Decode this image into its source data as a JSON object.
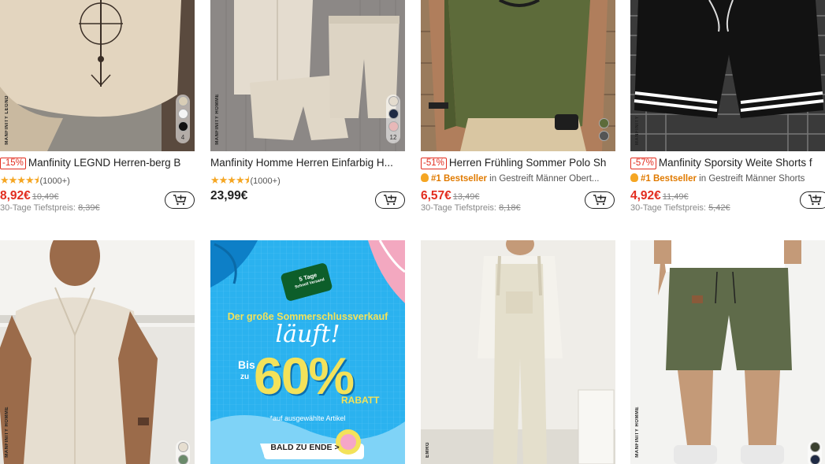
{
  "products": [
    {
      "brand_vertical": "MANFINITY LEGND",
      "discount": "-15%",
      "title": "Manfinity LEGND Herren-berg B",
      "rating_count": "(1000+)",
      "price": "8,92€",
      "old_price": "10,49€",
      "low_label": "30-Tage Tiefstpreis:",
      "low_price": "8,39€",
      "swatch_count": "4"
    },
    {
      "brand_vertical": "MANFINITY HOMME",
      "title": "Manfinity Homme Herren Einfarbig H...",
      "rating_count": "(1000+)",
      "price": "23,99€",
      "swatch_count": "12"
    },
    {
      "discount": "-51%",
      "title": "Herren Frühling Sommer Polo Sh",
      "bestseller": "#1 Bestseller",
      "bestseller_cat": "in Gestreift Männer Obert...",
      "price": "6,57€",
      "old_price": "13,49€",
      "low_label": "30-Tage Tiefstpreis:",
      "low_price": "8,18€"
    },
    {
      "brand_vertical": "MANFINITY",
      "discount": "-57%",
      "title": "Manfinity Sporsity Weite Shorts f",
      "bestseller": "#1 Bestseller",
      "bestseller_cat": "in Gestreift Männer Shorts",
      "price": "4,92€",
      "old_price": "11,49€",
      "low_label": "30-Tage Tiefstpreis:",
      "low_price": "5,42€"
    }
  ],
  "bottom": {
    "card1_brand": "MANFINITY HOMME",
    "card3_brand": "EMRG",
    "card4_brand": "MANFINITY HOMME"
  },
  "promo": {
    "badge_days": "5 Tage",
    "badge_sub": "Schnell Versand",
    "headline": "Der große Sommerschlussverkauf",
    "script": "läuft!",
    "bis": "Bis",
    "zu": "zu",
    "percent": "60%",
    "rabatt": "RABATT",
    "note": "*auf ausgewählte Artikel",
    "cta": "BALD ZU ENDE >"
  },
  "colors": {
    "accent": "#e22d1f",
    "bestseller": "#e07a00",
    "star": "#f5a623"
  }
}
